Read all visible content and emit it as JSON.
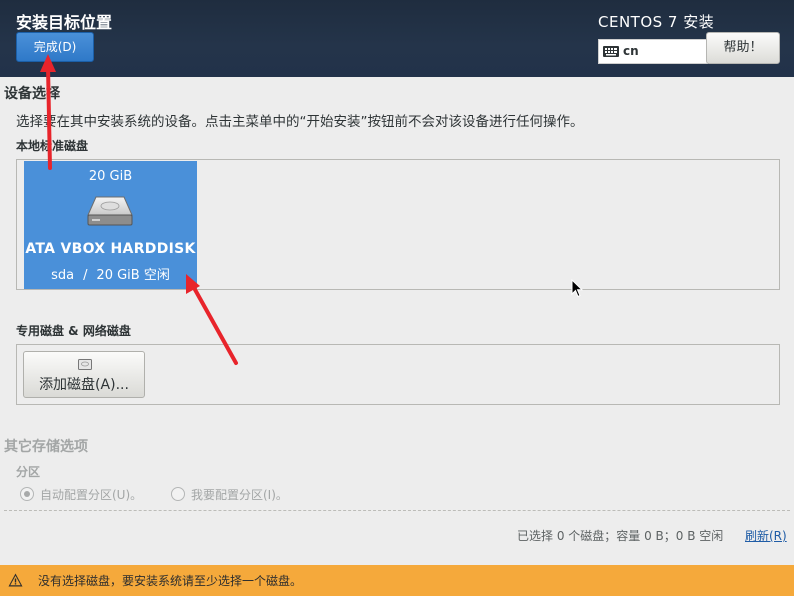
{
  "header": {
    "title": "安装目标位置",
    "done_label": "完成(D)",
    "product_title": "CENTOS 7 安装",
    "keyboard_layout": "cn",
    "help_label": "帮助！"
  },
  "device_selection": {
    "heading": "设备选择",
    "description": "选择要在其中安装系统的设备。点击主菜单中的“开始安装”按钮前不会对该设备进行任何操作。",
    "local_disks_label": "本地标准磁盘",
    "disks": [
      {
        "size": "20 GiB",
        "name": "ATA VBOX HARDDISK",
        "device": "sda",
        "separator": "/",
        "free": "20 GiB 空闲",
        "icon": "hard-disk-icon"
      }
    ],
    "specialized_label": "专用磁盘 & 网络磁盘",
    "add_disk_label": "添加磁盘(A)..."
  },
  "other_storage": {
    "heading": "其它存储选项",
    "partition_label": "分区",
    "auto_partition_label": "自动配置分区(U)。",
    "manual_partition_label": "我要配置分区(I)。",
    "auto_selected": true
  },
  "footer": {
    "summary": "已选择 0 个磁盘；容量 0 B；0 B 空闲",
    "refresh_label": "刷新(R)"
  },
  "warning": {
    "text": "没有选择磁盘，要安装系统请至少选择一个磁盘。",
    "icon": "warning-icon"
  },
  "colors": {
    "header_bg": "#22324a",
    "accent": "#4a90d9",
    "warning_bg": "#f5a93b",
    "annotation_arrow": "#e8242b"
  }
}
